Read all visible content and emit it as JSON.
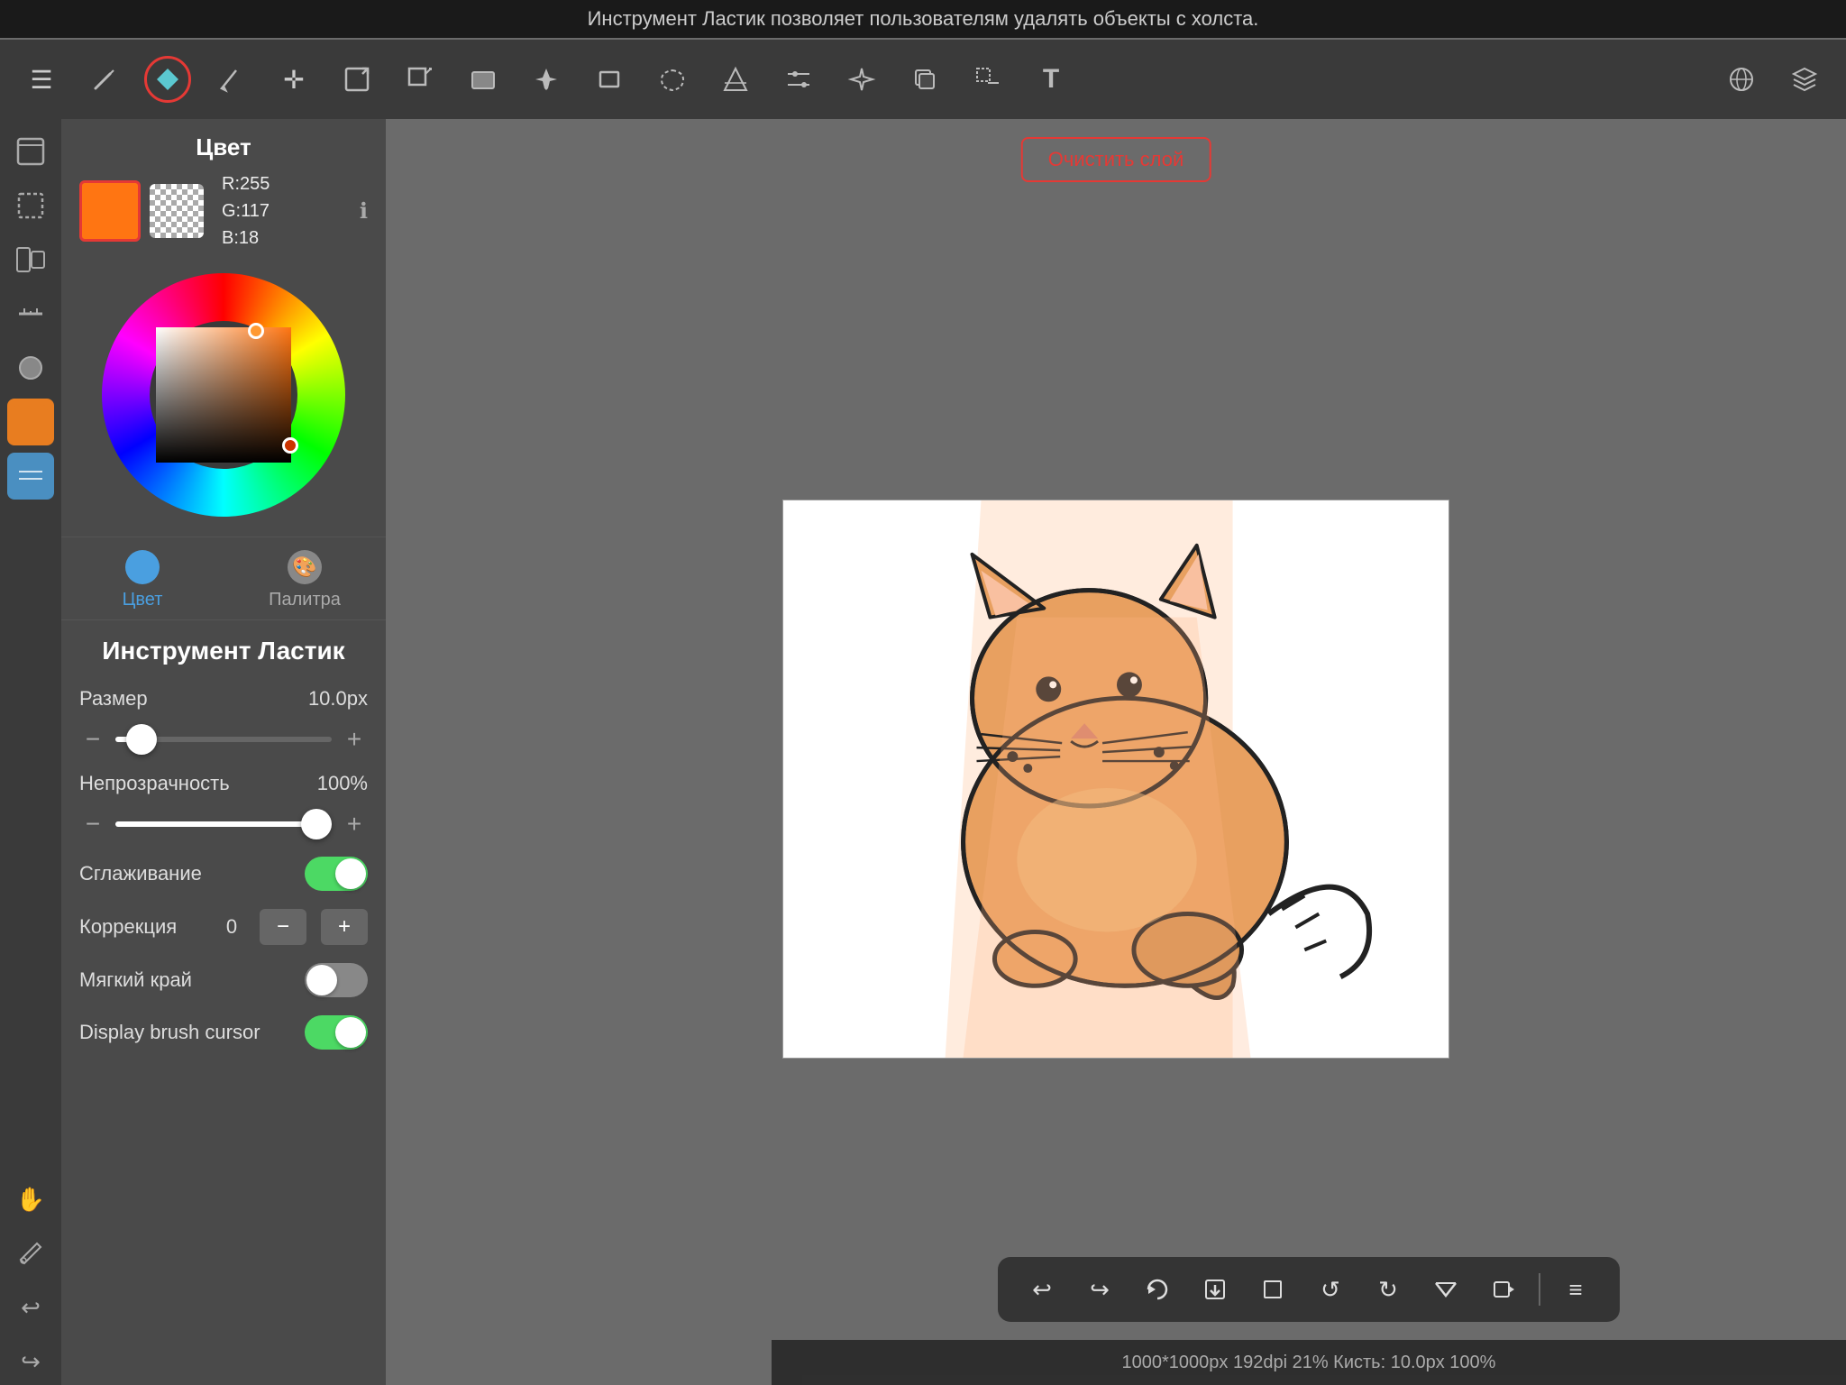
{
  "topBar": {
    "text": "Инструмент Ластик позволяет пользователям удалять объекты с холста."
  },
  "toolbar": {
    "tools": [
      {
        "name": "menu",
        "icon": "☰"
      },
      {
        "name": "pencil",
        "icon": "✏️"
      },
      {
        "name": "eraser-active",
        "icon": "◆"
      },
      {
        "name": "smudge",
        "icon": "✦"
      },
      {
        "name": "move",
        "icon": "✛"
      },
      {
        "name": "resize-canvas",
        "icon": "⬜"
      },
      {
        "name": "transform",
        "icon": "⤢"
      },
      {
        "name": "selection-fill",
        "icon": "⬛"
      },
      {
        "name": "fill",
        "icon": "◉"
      },
      {
        "name": "rectangle",
        "icon": "▭"
      },
      {
        "name": "lasso",
        "icon": "⬡"
      },
      {
        "name": "color-picker",
        "icon": "⋮"
      },
      {
        "name": "adjust",
        "icon": "⟋"
      },
      {
        "name": "wand",
        "icon": "◇"
      },
      {
        "name": "duplicate",
        "icon": "⊞"
      },
      {
        "name": "select-transform",
        "icon": "◫"
      },
      {
        "name": "text",
        "icon": "T"
      },
      {
        "name": "share",
        "icon": "⊕"
      },
      {
        "name": "layers",
        "icon": "⊛"
      }
    ]
  },
  "leftSidebar": {
    "icons": [
      {
        "name": "new-canvas",
        "icon": "⬜"
      },
      {
        "name": "selection",
        "icon": "⬛"
      },
      {
        "name": "adjustments",
        "icon": "⊞"
      },
      {
        "name": "ruler",
        "icon": "┤"
      },
      {
        "name": "brush",
        "icon": "●"
      },
      {
        "name": "current-color",
        "icon": ""
      },
      {
        "name": "layer",
        "icon": ""
      },
      {
        "name": "hand",
        "icon": "✋"
      },
      {
        "name": "eyedropper",
        "icon": "⊕"
      },
      {
        "name": "undo",
        "icon": "↩"
      },
      {
        "name": "redo",
        "icon": "↪"
      }
    ]
  },
  "panel": {
    "colorSection": {
      "title": "Цвет",
      "primaryColor": "#ff7512",
      "secondaryColor": "transparent",
      "r": 255,
      "g": 117,
      "b": 18,
      "rLabel": "R:255",
      "gLabel": "G:117",
      "bLabel": "B:18",
      "tabs": [
        {
          "name": "color",
          "label": "Цвет",
          "active": true
        },
        {
          "name": "palette",
          "label": "Палитра",
          "active": false
        }
      ]
    },
    "toolSettings": {
      "title": "Инструмент Ластик",
      "settings": [
        {
          "label": "Размер",
          "value": "10.0px",
          "type": "slider",
          "fillPercent": 12
        },
        {
          "label": "Непрозрачность",
          "value": "100%",
          "type": "slider",
          "fillPercent": 100
        },
        {
          "label": "Сглаживание",
          "value": "",
          "type": "toggle",
          "enabled": true
        },
        {
          "label": "Коррекция",
          "value": "0",
          "type": "stepper"
        },
        {
          "label": "Мягкий край",
          "value": "",
          "type": "toggle",
          "enabled": false
        },
        {
          "label": "Display brush cursor",
          "value": "",
          "type": "toggle",
          "enabled": true
        }
      ]
    }
  },
  "canvas": {
    "clearButtonLabel": "Очистить слой"
  },
  "bottomToolbar": {
    "tools": [
      {
        "name": "undo",
        "icon": "↩"
      },
      {
        "name": "redo",
        "icon": "↪"
      },
      {
        "name": "rotate-free",
        "icon": "↻"
      },
      {
        "name": "save",
        "icon": "⬇"
      },
      {
        "name": "crop",
        "icon": "⊡"
      },
      {
        "name": "rotate-ccw",
        "icon": "↺"
      },
      {
        "name": "rotate-cw",
        "icon": "↻"
      },
      {
        "name": "flip",
        "icon": "⟺"
      },
      {
        "name": "record",
        "icon": "⬛"
      },
      {
        "name": "menu",
        "icon": "≡"
      }
    ]
  },
  "statusBar": {
    "text": "1000*1000px 192dpi 21% Кисть: 10.0px 100%"
  }
}
